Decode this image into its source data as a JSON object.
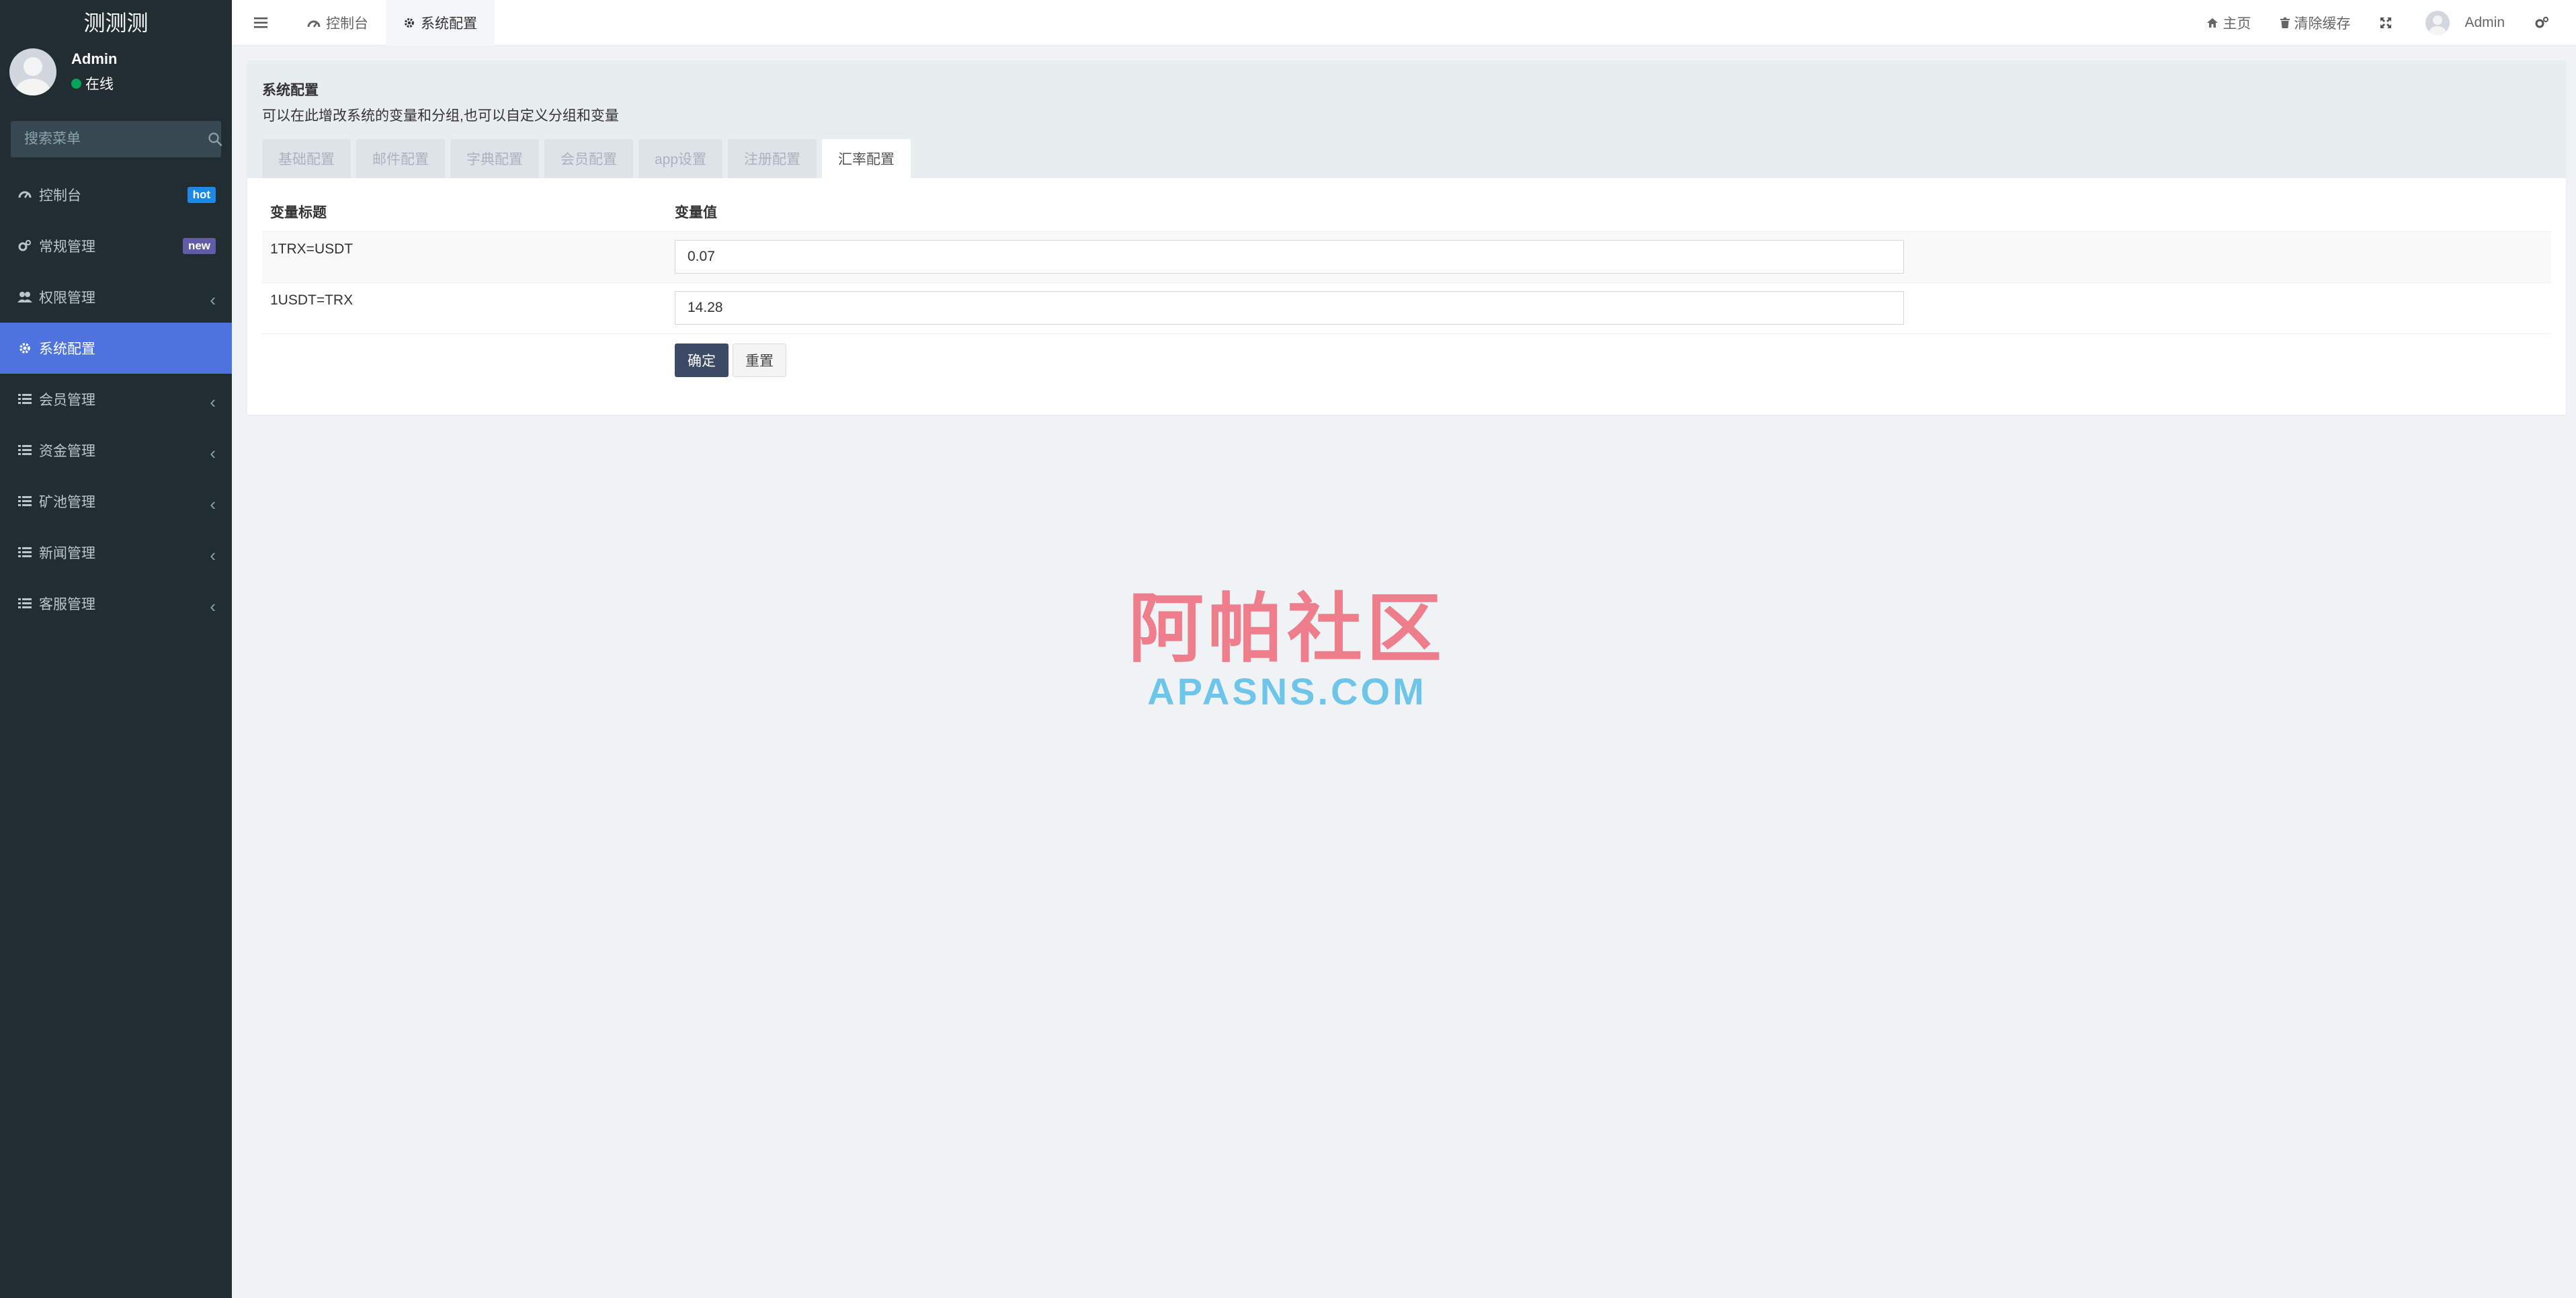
{
  "app": {
    "brand": "测测测"
  },
  "user": {
    "name": "Admin",
    "status": "在线"
  },
  "search": {
    "placeholder": "搜索菜单"
  },
  "sidebar": {
    "items": [
      {
        "label": "控制台",
        "badge": "hot",
        "badge_color": "#1e88e5"
      },
      {
        "label": "常规管理",
        "badge": "new",
        "badge_color": "#605ca8"
      },
      {
        "label": "权限管理",
        "chevron": "‹"
      },
      {
        "label": "系统配置"
      },
      {
        "label": "会员管理",
        "chevron": "‹"
      },
      {
        "label": "资金管理",
        "chevron": "‹"
      },
      {
        "label": "矿池管理",
        "chevron": "‹"
      },
      {
        "label": "新闻管理",
        "chevron": "‹"
      },
      {
        "label": "客服管理",
        "chevron": "‹"
      }
    ]
  },
  "topbar": {
    "tabs": [
      {
        "label": "控制台",
        "icon": "dashboard-icon"
      },
      {
        "label": "系统配置",
        "icon": "gear-icon"
      }
    ],
    "home_label": "主页",
    "clear_cache_label": "清除缓存",
    "admin_label": "Admin"
  },
  "panel": {
    "title": "系统配置",
    "description": "可以在此增改系统的变量和分组,也可以自定义分组和变量",
    "tabs": [
      "基础配置",
      "邮件配置",
      "字典配置",
      "会员配置",
      "app设置",
      "注册配置",
      "汇率配置"
    ],
    "active_tab": "汇率配置"
  },
  "table": {
    "headers": [
      "变量标题",
      "变量值"
    ],
    "rows": [
      {
        "title": "1TRX=USDT",
        "value": "0.07"
      },
      {
        "title": "1USDT=TRX",
        "value": "14.28"
      }
    ],
    "confirm_label": "确定",
    "reset_label": "重置"
  },
  "watermark": {
    "cn": "阿帕社区",
    "en": "APASNS.COM"
  },
  "colors": {
    "sidebar_bg": "#222d32",
    "active_menu": "#4e73df",
    "primary_button": "#3c4a66",
    "online_dot": "#00a65a"
  }
}
